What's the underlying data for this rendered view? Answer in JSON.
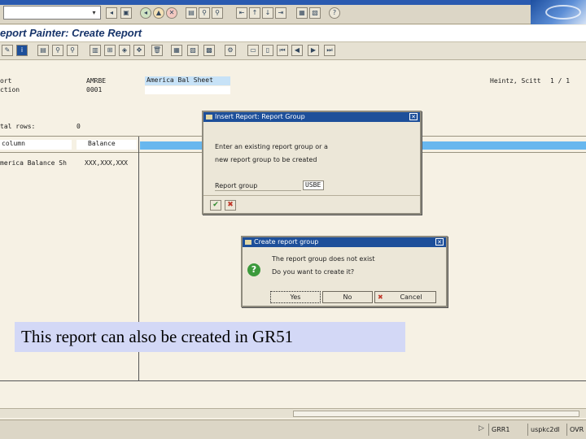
{
  "title": "eport Painter: Create Report",
  "header": {
    "label_report": "ort",
    "report_id": "AMRBE",
    "report_desc": "America Bal Sheet",
    "label_section": "ction",
    "section_id": "0001",
    "user": "Heintz, Scitt",
    "page": "1 / 1"
  },
  "body": {
    "label_total": "tal rows:",
    "total_value": "0",
    "label_column": "column",
    "column_value": "Balance",
    "label_row": "merica Balance Sh",
    "row_value": "XXX,XXX,XXX"
  },
  "dialog_insert": {
    "title": "Insert Report: Report Group",
    "line1": "Enter an existing report group or a",
    "line2": "new report group to be created",
    "field_label": "Report group",
    "field_value": "USBE"
  },
  "dialog_create": {
    "title": "Create report group",
    "line1": "The report group does not exist",
    "line2": "Do you want to create it?",
    "yes_label": "Yes",
    "no_label": "No",
    "cancel_label": "Cancel"
  },
  "caption": "This report can also be created in GR51",
  "status": {
    "system": "GRR1",
    "server": "uspkc2dl",
    "mode": "OVR"
  },
  "colors": {
    "title_text": "#17346a",
    "highlight_bar": "#68b7ee",
    "dialog_title": "#1d4f9a",
    "caption_bg": "#d3d8f6"
  }
}
